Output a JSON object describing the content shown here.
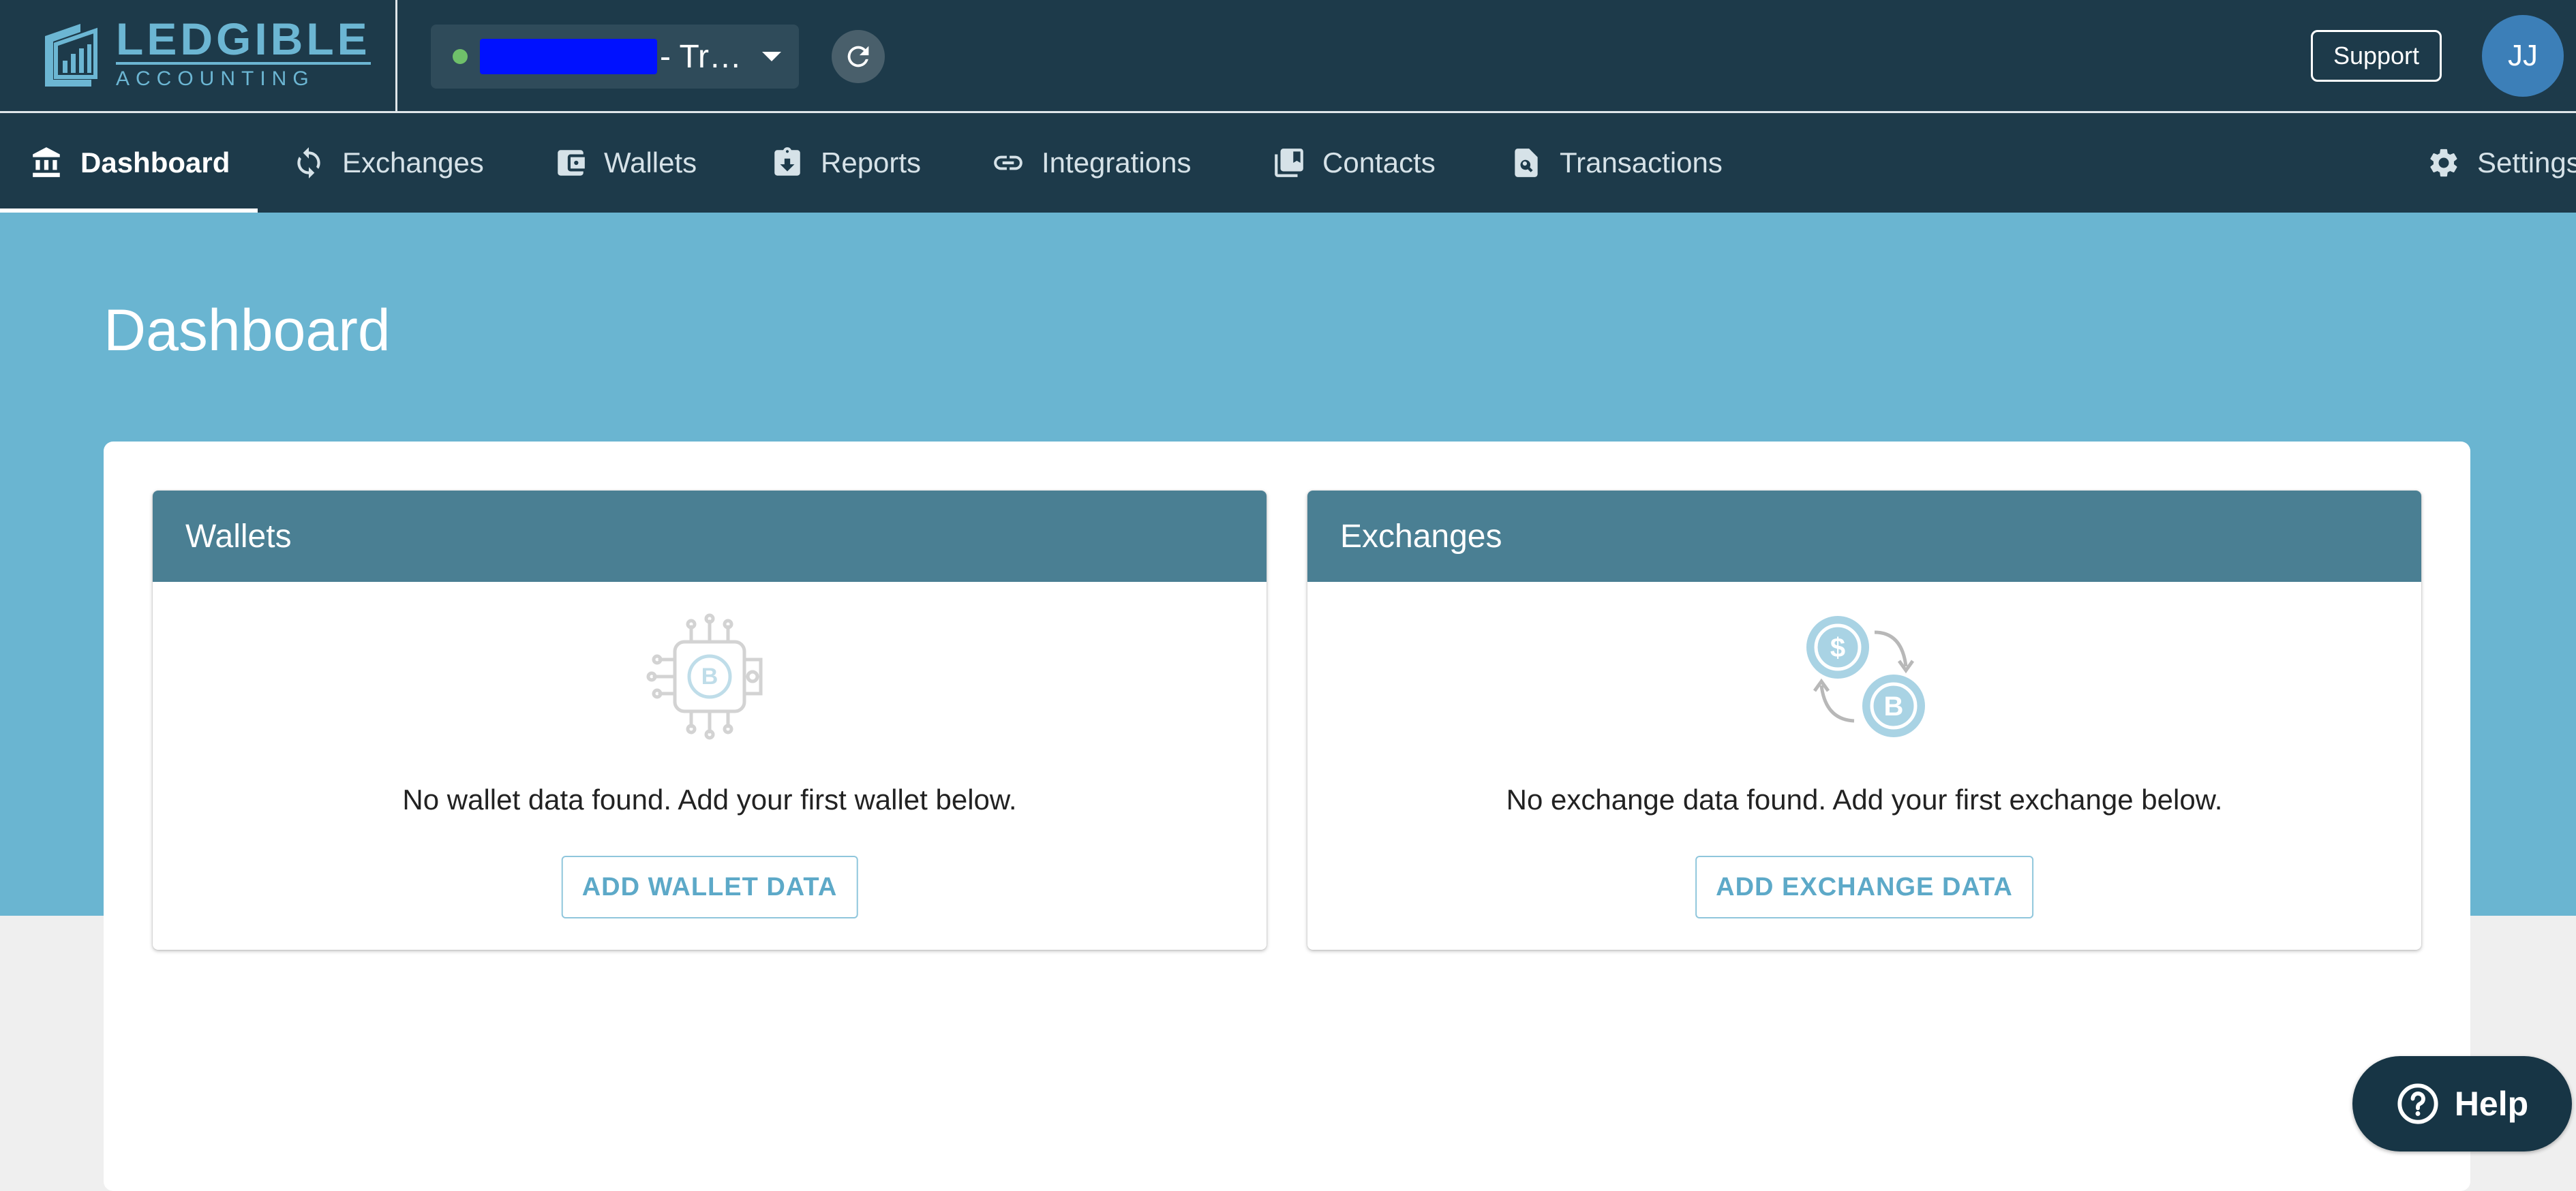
{
  "app": {
    "logo_name": "LEDGIBLE",
    "logo_sub": "ACCOUNTING",
    "org_label": "- Tr…",
    "support_label": "Support",
    "avatar_initials": "JJ"
  },
  "nav": {
    "items": [
      {
        "label": "Dashboard",
        "icon": "bank-icon",
        "active": true
      },
      {
        "label": "Exchanges",
        "icon": "sync-icon"
      },
      {
        "label": "Wallets",
        "icon": "wallet-icon"
      },
      {
        "label": "Reports",
        "icon": "clipboard-download-icon"
      },
      {
        "label": "Integrations",
        "icon": "link-icon"
      },
      {
        "label": "Contacts",
        "icon": "contacts-book-icon"
      },
      {
        "label": "Transactions",
        "icon": "document-search-icon"
      },
      {
        "label": "Settings",
        "icon": "gear-icon"
      }
    ]
  },
  "page": {
    "title": "Dashboard"
  },
  "wallets_card": {
    "title": "Wallets",
    "message": "No wallet data found. Add your first wallet below.",
    "button": "ADD WALLET DATA",
    "icon": "bitcoin-wallet-circuit-icon"
  },
  "exchanges_card": {
    "title": "Exchanges",
    "message": "No exchange data found. Add your first exchange below.",
    "button": "ADD EXCHANGE DATA",
    "icon": "dollar-bitcoin-exchange-icon"
  },
  "help": {
    "label": "Help"
  },
  "colors": {
    "topbar": "#1d3a4a",
    "hero": "#6ab5d1",
    "card_header": "#4a7f93",
    "accent": "#5da9c8",
    "help_button": "#173545"
  }
}
